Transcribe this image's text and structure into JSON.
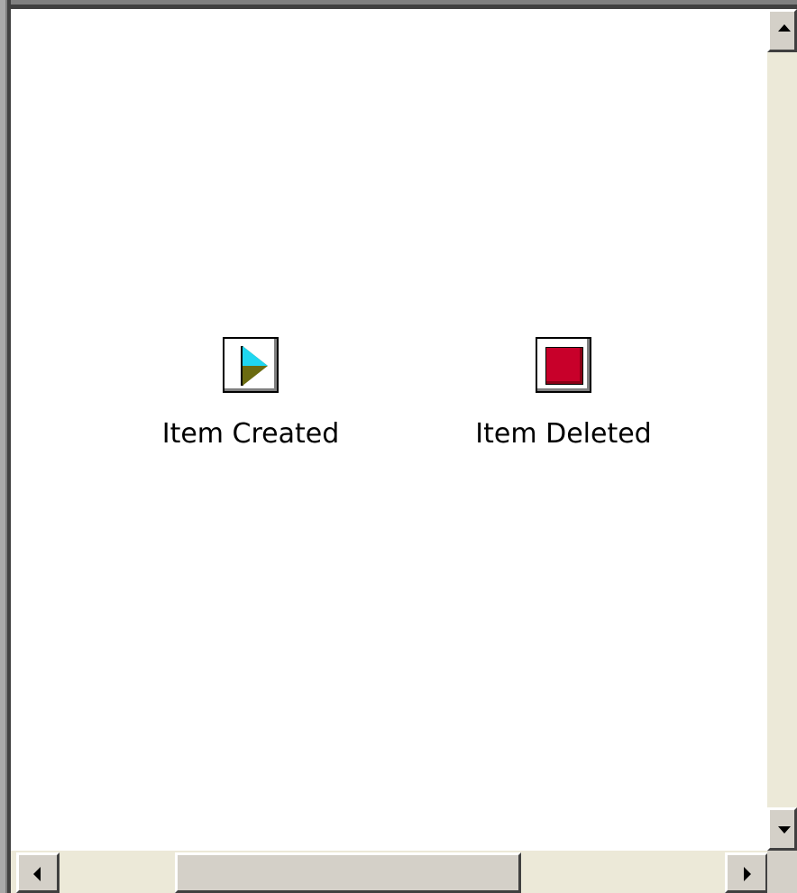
{
  "list": {
    "items": [
      {
        "label": "Item Created",
        "icon": "play-icon"
      },
      {
        "label": "Item Deleted",
        "icon": "stop-icon"
      }
    ]
  },
  "colors": {
    "play_light": "#1fd6f0",
    "play_dark": "#6b6b10",
    "stop": "#c8002a",
    "chrome": "#ece9d8"
  },
  "scrollbars": {
    "vertical_up_icon": "arrow-up-icon",
    "vertical_down_icon": "arrow-down-icon",
    "horizontal_left_icon": "arrow-left-icon",
    "horizontal_right_icon": "arrow-right-icon"
  }
}
